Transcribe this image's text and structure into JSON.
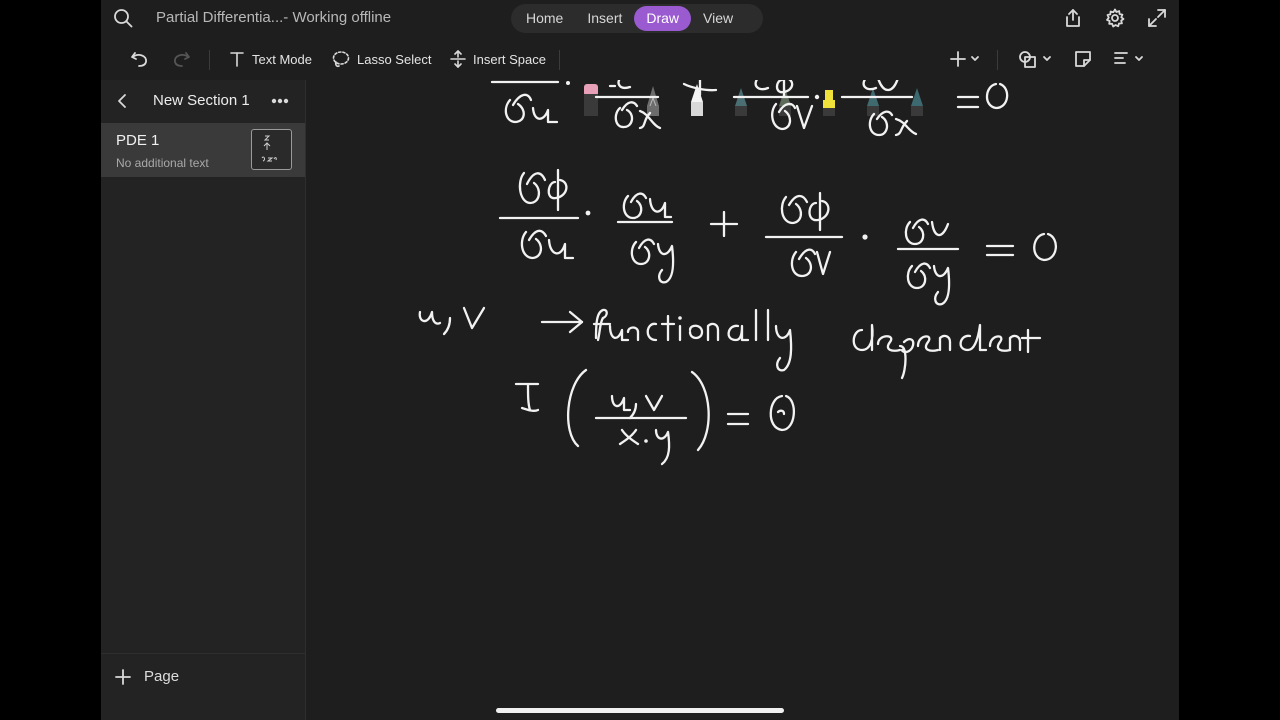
{
  "window": {
    "title": "Partial Differentia...- Working offline"
  },
  "tabs": [
    {
      "label": "Home",
      "active": false
    },
    {
      "label": "Insert",
      "active": false
    },
    {
      "label": "Draw",
      "active": true
    },
    {
      "label": "View",
      "active": false
    }
  ],
  "toolbar": {
    "text_mode": "Text Mode",
    "lasso_select": "Lasso Select",
    "insert_space": "Insert Space"
  },
  "pens": [
    {
      "name": "eraser",
      "color": "#e8a0b8"
    },
    {
      "name": "pen-gray-a",
      "color": "#6d6d6d"
    },
    {
      "name": "pen-white",
      "color": "#f4f4f4"
    },
    {
      "name": "pen-teal-1",
      "color": "#4a6e72"
    },
    {
      "name": "pen-olive",
      "color": "#5e6b5a"
    },
    {
      "name": "highlighter-yellow",
      "color": "#f0e23a"
    },
    {
      "name": "pen-teal-2",
      "color": "#3f6a6e"
    },
    {
      "name": "pen-teal-3",
      "color": "#3c6a70"
    }
  ],
  "sidebar": {
    "section_title": "New Section 1",
    "pages": [
      {
        "title": "PDE 1",
        "subtitle": "No additional text",
        "selected": true
      }
    ],
    "add_page_label": "Page"
  },
  "colors": {
    "accent": "#9a5ad0",
    "background": "#1e1e1e",
    "sidebar": "#232323",
    "selected_page": "#3a3a3a"
  }
}
